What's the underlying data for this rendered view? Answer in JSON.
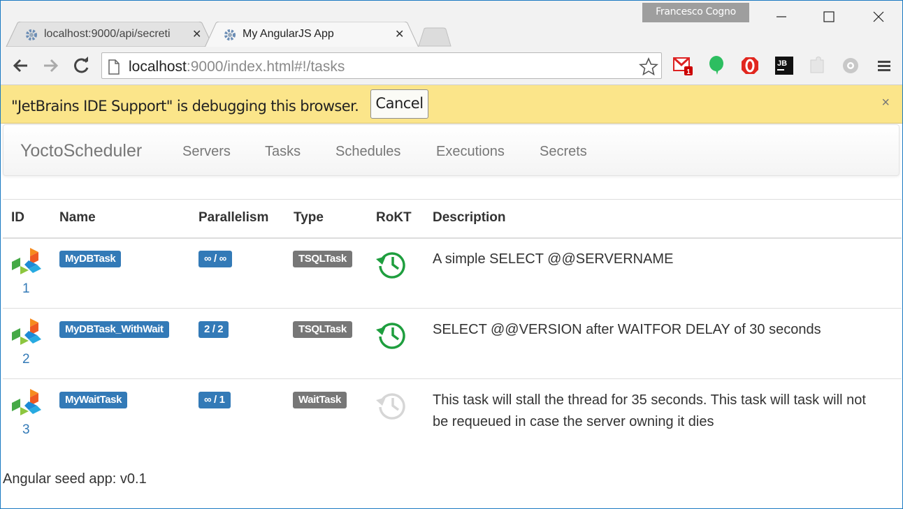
{
  "window": {
    "profile_name": "Francesco Cogno",
    "tabs": [
      {
        "title": "localhost:9000/api/secreti",
        "active": false
      },
      {
        "title": "My AngularJS App",
        "active": true
      }
    ]
  },
  "toolbar": {
    "url_host": "localhost",
    "url_rest": ":9000/index.html#!/tasks",
    "extensions": [
      "gmail-notifier-icon",
      "evernote-icon",
      "opera-vpn-icon",
      "jetbrains-icon",
      "puzzle-icon",
      "settings-icon"
    ]
  },
  "infobar": {
    "message": "\"JetBrains IDE Support\" is debugging this browser.",
    "cancel_label": "Cancel",
    "dismiss_label": "×"
  },
  "navbar": {
    "brand": "YoctoScheduler",
    "links": [
      "Servers",
      "Tasks",
      "Schedules",
      "Executions",
      "Secrets"
    ]
  },
  "table": {
    "headers": [
      "ID",
      "Name",
      "Parallelism",
      "Type",
      "RoKT",
      "Description"
    ],
    "rows": [
      {
        "id": "1",
        "name": "MyDBTask",
        "parallelism": "∞ / ∞",
        "type": "TSQLTask",
        "rokt": true,
        "description": "A simple SELECT @@SERVERNAME"
      },
      {
        "id": "2",
        "name": "MyDBTask_WithWait",
        "parallelism": "2 / 2",
        "type": "TSQLTask",
        "rokt": true,
        "description": "SELECT @@VERSION after WAITFOR DELAY of 30 seconds"
      },
      {
        "id": "3",
        "name": "MyWaitTask",
        "parallelism": "∞ / 1",
        "type": "WaitTask",
        "rokt": false,
        "description": "This task will stall the thread for 35 seconds. This task will task will not be requeued in case the server owning it dies"
      }
    ]
  },
  "footer": {
    "text": "Angular seed app: v0.1"
  },
  "colors": {
    "label_primary": "#337ab7",
    "label_default": "#777777",
    "rokt_enabled": "#1e9e3e",
    "rokt_disabled": "#d6d6d6",
    "infobar_bg": "#fbe58a"
  }
}
